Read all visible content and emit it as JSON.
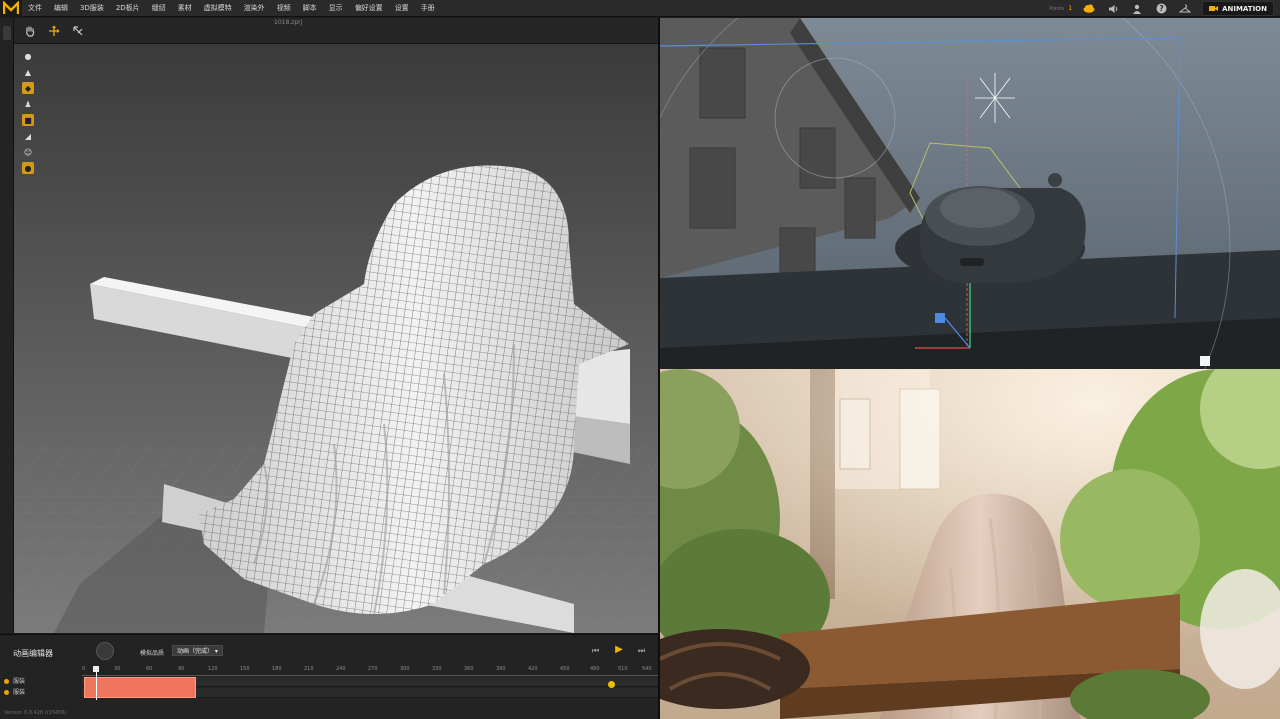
{
  "app": {
    "logo_text": "M",
    "file_name": "1018.zprj",
    "mode_label": "ANIMATION",
    "counter_label": "Points",
    "counter_value": "1"
  },
  "menu": {
    "items": [
      "文件",
      "编辑",
      "3D服装",
      "2D板片",
      "缝纫",
      "素材",
      "虚拟模特",
      "渲染外",
      "视频",
      "脚本",
      "显示",
      "偏好设置",
      "设置",
      "手册"
    ]
  },
  "toolbar": {
    "icons": [
      "hand-icon",
      "move-gizmo-icon",
      "select-icon"
    ]
  },
  "side_tools": {
    "icons": [
      "avatar-icon",
      "garment-icon",
      "fold-icon",
      "person-icon",
      "pin-icon",
      "measure-icon",
      "figure-icon",
      "sphere-icon"
    ]
  },
  "animation": {
    "title": "动画编辑器",
    "sim_quality_label": "模拟品质",
    "sim_quality_value": "动画（完成）",
    "ticks": [
      "0",
      "30",
      "60",
      "90",
      "120",
      "150",
      "180",
      "210",
      "240",
      "270",
      "300",
      "330",
      "360",
      "390",
      "420",
      "450",
      "480",
      "510",
      "540"
    ],
    "tracks": [
      {
        "label": "服装"
      },
      {
        "label": "服装"
      }
    ],
    "version": "Version 6.0.428 (r15456)"
  },
  "colors": {
    "accent": "#f3b000",
    "clip": "#f0755f",
    "menubar": "#2a2a2a"
  }
}
